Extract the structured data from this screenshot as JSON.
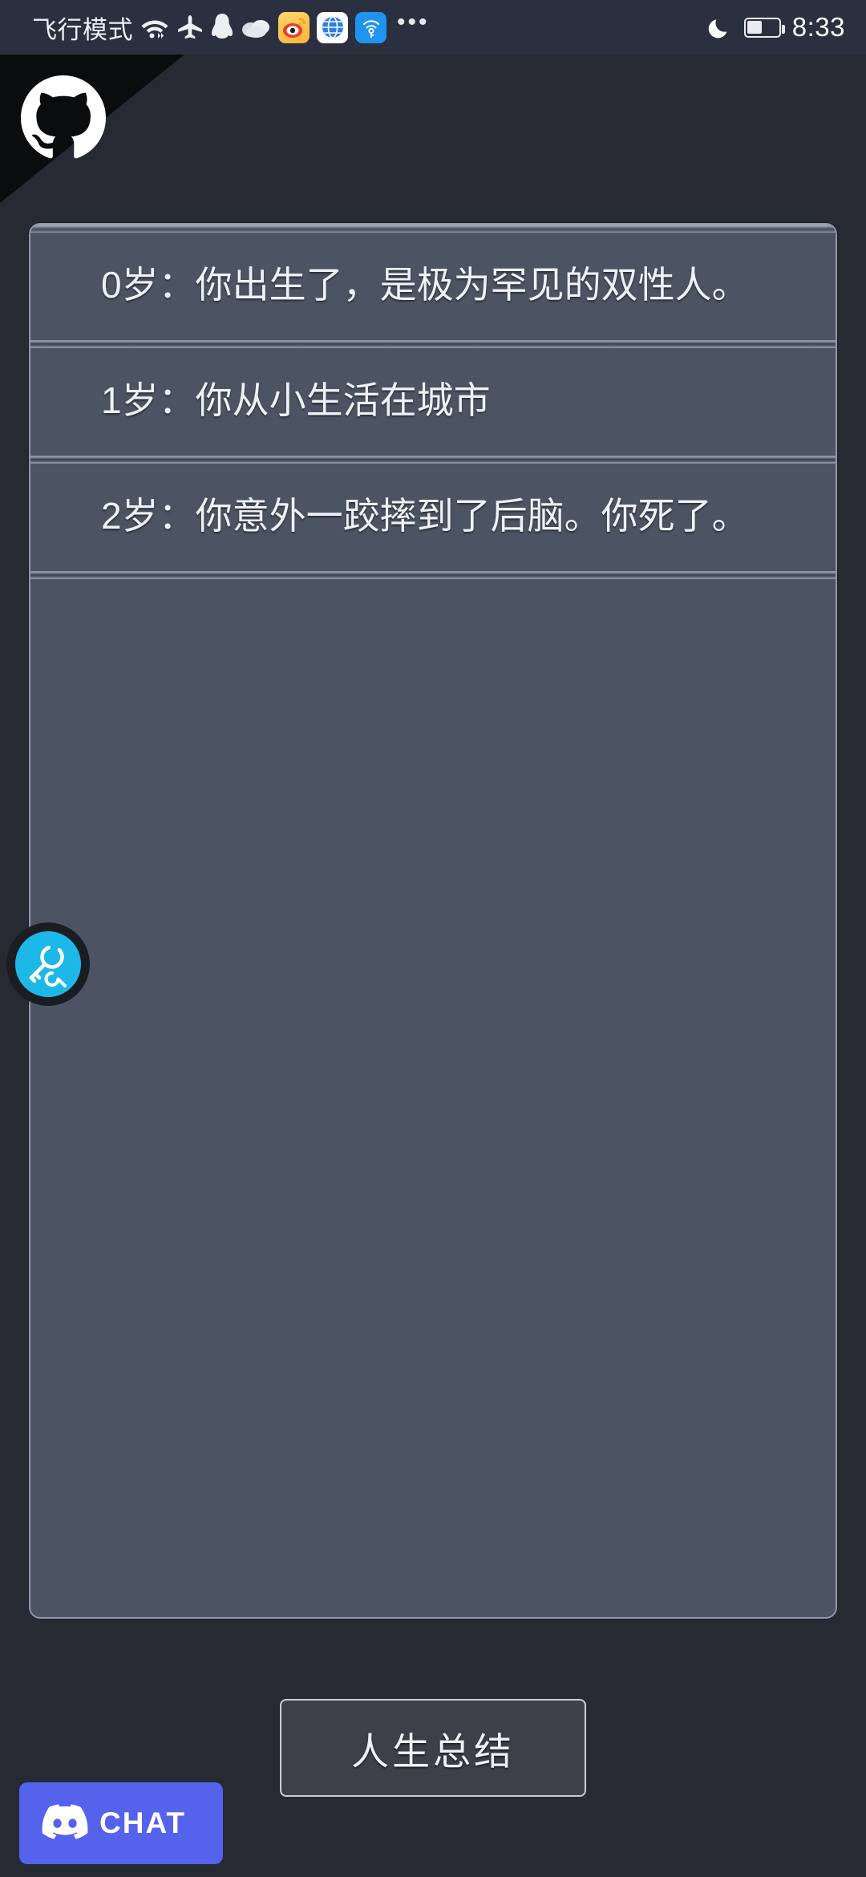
{
  "status_bar": {
    "mode_label": "飞行模式",
    "time": "8:33",
    "overflow_dots": "•••",
    "icons": [
      {
        "name": "wifi-icon"
      },
      {
        "name": "airplane-icon"
      },
      {
        "name": "qq-penguin-icon"
      },
      {
        "name": "cloud-icon"
      },
      {
        "name": "weibo-app-icon"
      },
      {
        "name": "browser-globe-app-icon"
      },
      {
        "name": "wifi-key-app-icon"
      }
    ],
    "right_icons": [
      {
        "name": "do-not-disturb-moon-icon"
      },
      {
        "name": "battery-icon",
        "level_percent": 42
      }
    ]
  },
  "corner_ribbon": {
    "icon": "github-octocat-icon"
  },
  "life_log": {
    "events": [
      {
        "age_label": "0岁：",
        "text": "你出生了，是极为罕见的双性人。"
      },
      {
        "age_label": "1岁：",
        "text": "你从小生活在城市"
      },
      {
        "age_label": "2岁：",
        "text": "你意外一跤摔到了后脑。你死了。"
      }
    ]
  },
  "floating_button": {
    "name": "key-fab",
    "icon": "key-icon",
    "color": "#1eb8e8"
  },
  "bottom": {
    "summary_button_label": "人生总结",
    "chat_button_label": "CHAT",
    "chat_icon": "discord-icon",
    "chat_color": "#5562ec"
  },
  "colors": {
    "page_background": "#252a33",
    "panel_background": "#4c5464",
    "panel_border": "#8f98a8",
    "status_bar_background": "#2a3040",
    "text": "#eef1f6"
  }
}
